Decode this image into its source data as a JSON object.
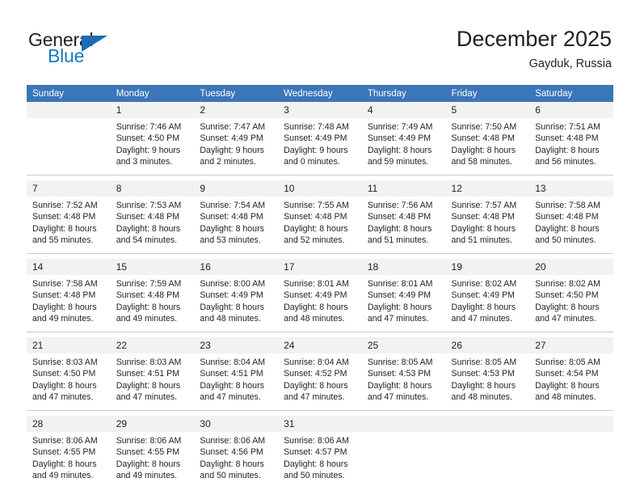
{
  "brand": {
    "name_top": "General",
    "name_bottom": "Blue",
    "accent_color": "#1b6cb0"
  },
  "header": {
    "title": "December 2025",
    "location": "Gayduk, Russia"
  },
  "calendar": {
    "header_bg": "#3a76b8",
    "daynum_bg": "#f2f2f2",
    "weekdays": [
      "Sunday",
      "Monday",
      "Tuesday",
      "Wednesday",
      "Thursday",
      "Friday",
      "Saturday"
    ],
    "weeks": [
      [
        {
          "day": "",
          "sunrise": "",
          "sunset": "",
          "daylight1": "",
          "daylight2": ""
        },
        {
          "day": "1",
          "sunrise": "Sunrise: 7:46 AM",
          "sunset": "Sunset: 4:50 PM",
          "daylight1": "Daylight: 9 hours",
          "daylight2": "and 3 minutes."
        },
        {
          "day": "2",
          "sunrise": "Sunrise: 7:47 AM",
          "sunset": "Sunset: 4:49 PM",
          "daylight1": "Daylight: 9 hours",
          "daylight2": "and 2 minutes."
        },
        {
          "day": "3",
          "sunrise": "Sunrise: 7:48 AM",
          "sunset": "Sunset: 4:49 PM",
          "daylight1": "Daylight: 9 hours",
          "daylight2": "and 0 minutes."
        },
        {
          "day": "4",
          "sunrise": "Sunrise: 7:49 AM",
          "sunset": "Sunset: 4:49 PM",
          "daylight1": "Daylight: 8 hours",
          "daylight2": "and 59 minutes."
        },
        {
          "day": "5",
          "sunrise": "Sunrise: 7:50 AM",
          "sunset": "Sunset: 4:48 PM",
          "daylight1": "Daylight: 8 hours",
          "daylight2": "and 58 minutes."
        },
        {
          "day": "6",
          "sunrise": "Sunrise: 7:51 AM",
          "sunset": "Sunset: 4:48 PM",
          "daylight1": "Daylight: 8 hours",
          "daylight2": "and 56 minutes."
        }
      ],
      [
        {
          "day": "7",
          "sunrise": "Sunrise: 7:52 AM",
          "sunset": "Sunset: 4:48 PM",
          "daylight1": "Daylight: 8 hours",
          "daylight2": "and 55 minutes."
        },
        {
          "day": "8",
          "sunrise": "Sunrise: 7:53 AM",
          "sunset": "Sunset: 4:48 PM",
          "daylight1": "Daylight: 8 hours",
          "daylight2": "and 54 minutes."
        },
        {
          "day": "9",
          "sunrise": "Sunrise: 7:54 AM",
          "sunset": "Sunset: 4:48 PM",
          "daylight1": "Daylight: 8 hours",
          "daylight2": "and 53 minutes."
        },
        {
          "day": "10",
          "sunrise": "Sunrise: 7:55 AM",
          "sunset": "Sunset: 4:48 PM",
          "daylight1": "Daylight: 8 hours",
          "daylight2": "and 52 minutes."
        },
        {
          "day": "11",
          "sunrise": "Sunrise: 7:56 AM",
          "sunset": "Sunset: 4:48 PM",
          "daylight1": "Daylight: 8 hours",
          "daylight2": "and 51 minutes."
        },
        {
          "day": "12",
          "sunrise": "Sunrise: 7:57 AM",
          "sunset": "Sunset: 4:48 PM",
          "daylight1": "Daylight: 8 hours",
          "daylight2": "and 51 minutes."
        },
        {
          "day": "13",
          "sunrise": "Sunrise: 7:58 AM",
          "sunset": "Sunset: 4:48 PM",
          "daylight1": "Daylight: 8 hours",
          "daylight2": "and 50 minutes."
        }
      ],
      [
        {
          "day": "14",
          "sunrise": "Sunrise: 7:58 AM",
          "sunset": "Sunset: 4:48 PM",
          "daylight1": "Daylight: 8 hours",
          "daylight2": "and 49 minutes."
        },
        {
          "day": "15",
          "sunrise": "Sunrise: 7:59 AM",
          "sunset": "Sunset: 4:48 PM",
          "daylight1": "Daylight: 8 hours",
          "daylight2": "and 49 minutes."
        },
        {
          "day": "16",
          "sunrise": "Sunrise: 8:00 AM",
          "sunset": "Sunset: 4:49 PM",
          "daylight1": "Daylight: 8 hours",
          "daylight2": "and 48 minutes."
        },
        {
          "day": "17",
          "sunrise": "Sunrise: 8:01 AM",
          "sunset": "Sunset: 4:49 PM",
          "daylight1": "Daylight: 8 hours",
          "daylight2": "and 48 minutes."
        },
        {
          "day": "18",
          "sunrise": "Sunrise: 8:01 AM",
          "sunset": "Sunset: 4:49 PM",
          "daylight1": "Daylight: 8 hours",
          "daylight2": "and 47 minutes."
        },
        {
          "day": "19",
          "sunrise": "Sunrise: 8:02 AM",
          "sunset": "Sunset: 4:49 PM",
          "daylight1": "Daylight: 8 hours",
          "daylight2": "and 47 minutes."
        },
        {
          "day": "20",
          "sunrise": "Sunrise: 8:02 AM",
          "sunset": "Sunset: 4:50 PM",
          "daylight1": "Daylight: 8 hours",
          "daylight2": "and 47 minutes."
        }
      ],
      [
        {
          "day": "21",
          "sunrise": "Sunrise: 8:03 AM",
          "sunset": "Sunset: 4:50 PM",
          "daylight1": "Daylight: 8 hours",
          "daylight2": "and 47 minutes."
        },
        {
          "day": "22",
          "sunrise": "Sunrise: 8:03 AM",
          "sunset": "Sunset: 4:51 PM",
          "daylight1": "Daylight: 8 hours",
          "daylight2": "and 47 minutes."
        },
        {
          "day": "23",
          "sunrise": "Sunrise: 8:04 AM",
          "sunset": "Sunset: 4:51 PM",
          "daylight1": "Daylight: 8 hours",
          "daylight2": "and 47 minutes."
        },
        {
          "day": "24",
          "sunrise": "Sunrise: 8:04 AM",
          "sunset": "Sunset: 4:52 PM",
          "daylight1": "Daylight: 8 hours",
          "daylight2": "and 47 minutes."
        },
        {
          "day": "25",
          "sunrise": "Sunrise: 8:05 AM",
          "sunset": "Sunset: 4:53 PM",
          "daylight1": "Daylight: 8 hours",
          "daylight2": "and 47 minutes."
        },
        {
          "day": "26",
          "sunrise": "Sunrise: 8:05 AM",
          "sunset": "Sunset: 4:53 PM",
          "daylight1": "Daylight: 8 hours",
          "daylight2": "and 48 minutes."
        },
        {
          "day": "27",
          "sunrise": "Sunrise: 8:05 AM",
          "sunset": "Sunset: 4:54 PM",
          "daylight1": "Daylight: 8 hours",
          "daylight2": "and 48 minutes."
        }
      ],
      [
        {
          "day": "28",
          "sunrise": "Sunrise: 8:06 AM",
          "sunset": "Sunset: 4:55 PM",
          "daylight1": "Daylight: 8 hours",
          "daylight2": "and 49 minutes."
        },
        {
          "day": "29",
          "sunrise": "Sunrise: 8:06 AM",
          "sunset": "Sunset: 4:55 PM",
          "daylight1": "Daylight: 8 hours",
          "daylight2": "and 49 minutes."
        },
        {
          "day": "30",
          "sunrise": "Sunrise: 8:06 AM",
          "sunset": "Sunset: 4:56 PM",
          "daylight1": "Daylight: 8 hours",
          "daylight2": "and 50 minutes."
        },
        {
          "day": "31",
          "sunrise": "Sunrise: 8:06 AM",
          "sunset": "Sunset: 4:57 PM",
          "daylight1": "Daylight: 8 hours",
          "daylight2": "and 50 minutes."
        },
        {
          "day": "",
          "sunrise": "",
          "sunset": "",
          "daylight1": "",
          "daylight2": ""
        },
        {
          "day": "",
          "sunrise": "",
          "sunset": "",
          "daylight1": "",
          "daylight2": ""
        },
        {
          "day": "",
          "sunrise": "",
          "sunset": "",
          "daylight1": "",
          "daylight2": ""
        }
      ]
    ]
  }
}
